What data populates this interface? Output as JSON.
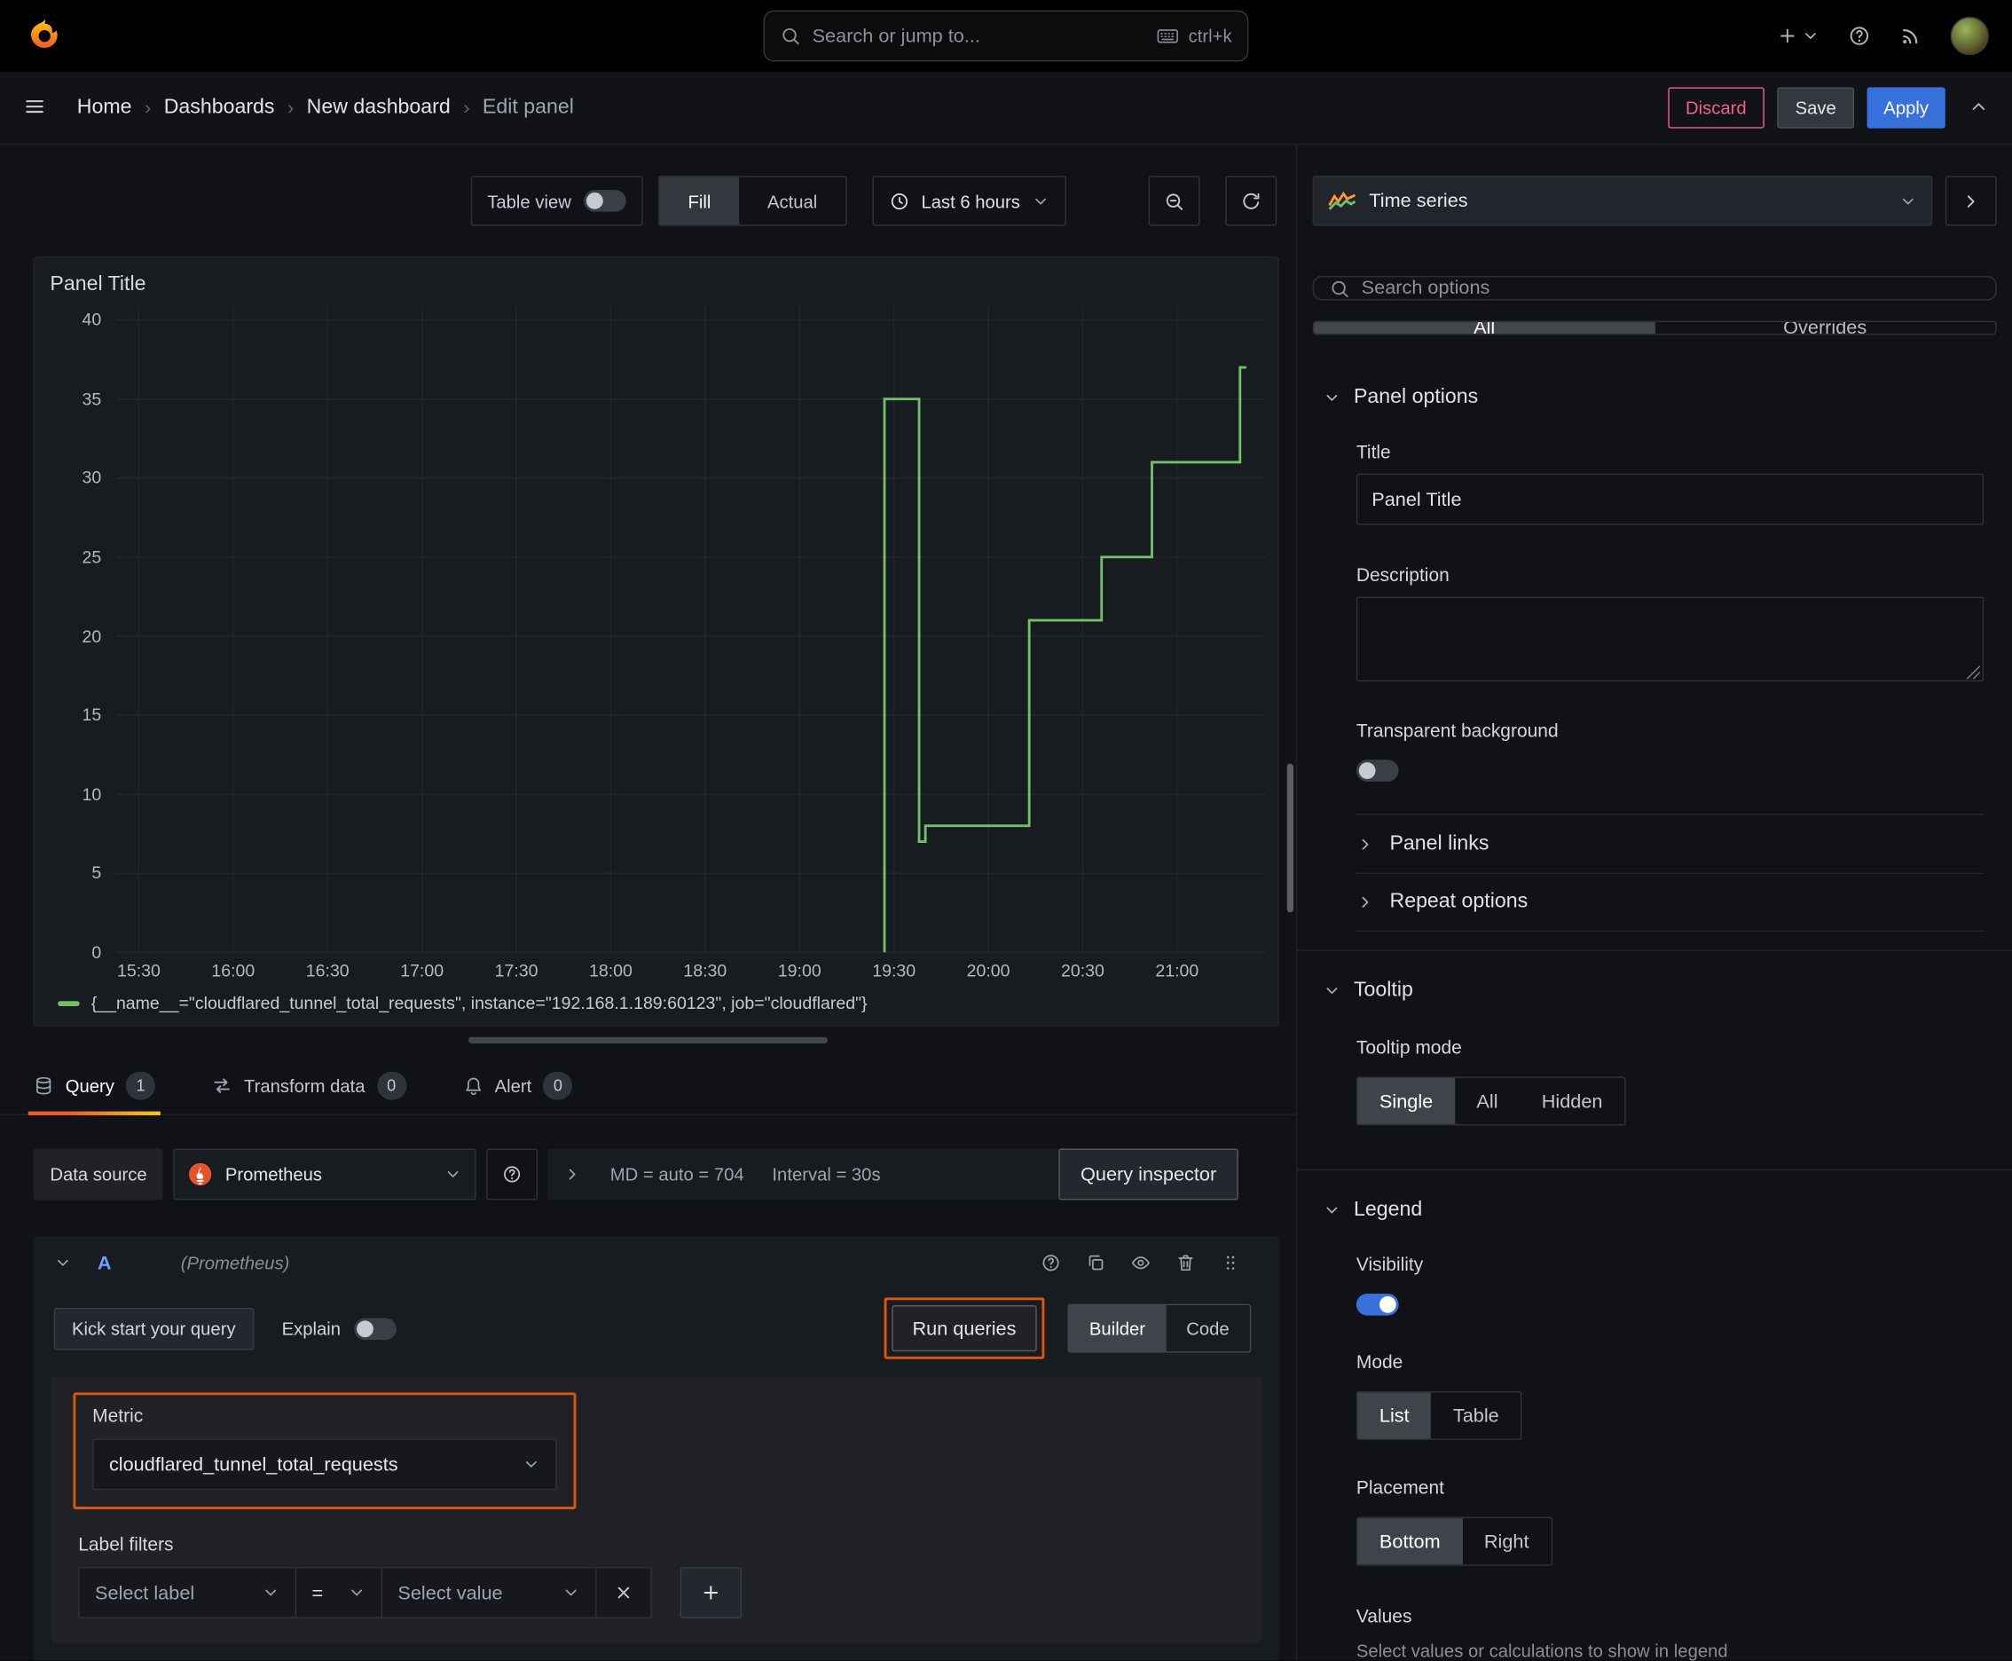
{
  "topnav": {
    "search_placeholder": "Search or jump to...",
    "search_shortcut": "ctrl+k"
  },
  "breadcrumb_bar": {
    "items": [
      "Home",
      "Dashboards",
      "New dashboard",
      "Edit panel"
    ],
    "discard_label": "Discard",
    "save_label": "Save",
    "apply_label": "Apply"
  },
  "toolbar": {
    "table_view_label": "Table view",
    "fill_label": "Fill",
    "actual_label": "Actual",
    "time_range_label": "Last 6 hours"
  },
  "panel": {
    "title": "Panel Title"
  },
  "chart_data": {
    "type": "line",
    "title": "Panel Title",
    "line_color": "#73BF69",
    "grid": true,
    "legend_position": "bottom",
    "ylim": [
      0,
      40
    ],
    "y_ticks": [
      0,
      5,
      10,
      15,
      20,
      25,
      30,
      35,
      40
    ],
    "x_ticks": [
      "15:30",
      "16:00",
      "16:30",
      "17:00",
      "17:30",
      "18:00",
      "18:30",
      "19:00",
      "19:30",
      "20:00",
      "20:30",
      "21:00"
    ],
    "x_domain": [
      "15:23",
      "21:28"
    ],
    "series": [
      {
        "name": "{__name__=\"cloudflared_tunnel_total_requests\", instance=\"192.168.1.189:60123\", job=\"cloudflared\"}",
        "points": [
          [
            "19:27",
            0
          ],
          [
            "19:27",
            35
          ],
          [
            "19:38",
            35
          ],
          [
            "19:38",
            7
          ],
          [
            "19:40",
            7
          ],
          [
            "19:40",
            8
          ],
          [
            "20:13",
            8
          ],
          [
            "20:13",
            21
          ],
          [
            "20:36",
            21
          ],
          [
            "20:36",
            25
          ],
          [
            "20:52",
            25
          ],
          [
            "20:52",
            31
          ],
          [
            "21:20",
            31
          ],
          [
            "21:20",
            37
          ],
          [
            "21:22",
            37
          ]
        ]
      }
    ]
  },
  "query_tabs": {
    "query_label": "Query",
    "query_count": "1",
    "transform_label": "Transform data",
    "transform_count": "0",
    "alert_label": "Alert",
    "alert_count": "0"
  },
  "datasource_row": {
    "label": "Data source",
    "name": "Prometheus",
    "stats_md": "MD = auto = 704",
    "stats_interval": "Interval = 30s",
    "query_inspector_label": "Query inspector"
  },
  "query_editor": {
    "ref_id": "A",
    "ds_hint": "(Prometheus)",
    "kickstart_label": "Kick start your query",
    "explain_label": "Explain",
    "run_queries_label": "Run queries",
    "builder_label": "Builder",
    "code_label": "Code",
    "metric_label": "Metric",
    "metric_value": "cloudflared_tunnel_total_requests",
    "label_filters_label": "Label filters",
    "select_label_placeholder": "Select label",
    "operator": "=",
    "select_value_placeholder": "Select value"
  },
  "sidebar": {
    "viz_name": "Time series",
    "search_placeholder": "Search options",
    "tab_all": "All",
    "tab_overrides": "Overrides",
    "panel_options": {
      "title": "Panel options",
      "title_label": "Title",
      "title_value": "Panel Title",
      "description_label": "Description",
      "transparent_label": "Transparent background",
      "panel_links_label": "Panel links",
      "repeat_options_label": "Repeat options"
    },
    "tooltip": {
      "title": "Tooltip",
      "mode_label": "Tooltip mode",
      "options": [
        "Single",
        "All",
        "Hidden"
      ],
      "selected": "Single"
    },
    "legend": {
      "title": "Legend",
      "visibility_label": "Visibility",
      "mode_label": "Mode",
      "mode_options": [
        "List",
        "Table"
      ],
      "mode_selected": "List",
      "placement_label": "Placement",
      "placement_options": [
        "Bottom",
        "Right"
      ],
      "placement_selected": "Bottom",
      "values_label": "Values",
      "values_hint": "Select values or calculations to show in legend"
    }
  },
  "toggles": {
    "table_view": false,
    "explain": false,
    "transparent_background": false,
    "legend_visibility": true
  },
  "colors": {
    "accent_blue": "#3871DC",
    "series_green": "#73BF69",
    "highlight_orange": "#D9580F",
    "discard_pink": "#F55F8E",
    "active_tab_gradient": [
      "#F05A28",
      "#FBCA0A"
    ]
  }
}
